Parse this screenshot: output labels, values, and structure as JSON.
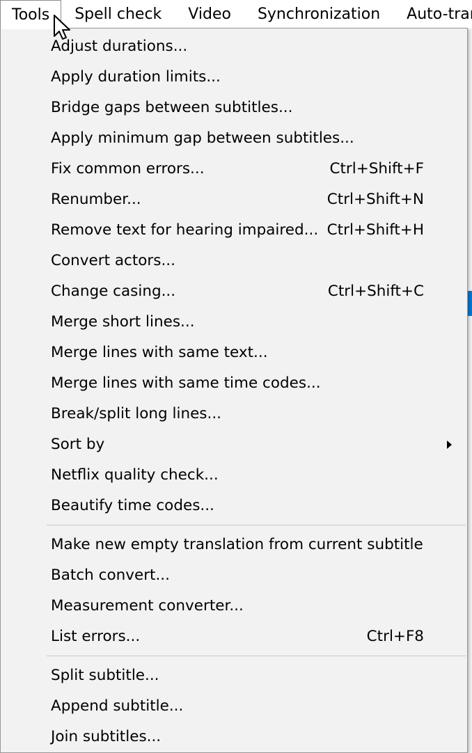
{
  "menubar": {
    "items": [
      {
        "label": "Tools",
        "active": true
      },
      {
        "label": "Spell check"
      },
      {
        "label": "Video"
      },
      {
        "label": "Synchronization"
      },
      {
        "label": "Auto-tran"
      }
    ]
  },
  "tools_menu": {
    "group1": [
      {
        "label": "Adjust durations...",
        "shortcut": ""
      },
      {
        "label": "Apply duration limits...",
        "shortcut": ""
      },
      {
        "label": "Bridge gaps between subtitles...",
        "shortcut": ""
      },
      {
        "label": "Apply minimum gap between subtitles...",
        "shortcut": ""
      },
      {
        "label": "Fix common errors...",
        "shortcut": "Ctrl+Shift+F"
      },
      {
        "label": "Renumber...",
        "shortcut": "Ctrl+Shift+N"
      },
      {
        "label": "Remove text for hearing impaired...",
        "shortcut": "Ctrl+Shift+H"
      },
      {
        "label": "Convert actors...",
        "shortcut": ""
      },
      {
        "label": "Change casing...",
        "shortcut": "Ctrl+Shift+C"
      },
      {
        "label": "Merge short lines...",
        "shortcut": ""
      },
      {
        "label": "Merge lines with same text...",
        "shortcut": ""
      },
      {
        "label": "Merge lines with same time codes...",
        "shortcut": ""
      },
      {
        "label": "Break/split long lines...",
        "shortcut": ""
      },
      {
        "label": "Sort by",
        "shortcut": "",
        "submenu": true
      },
      {
        "label": "Netflix quality check...",
        "shortcut": ""
      },
      {
        "label": "Beautify time codes...",
        "shortcut": ""
      }
    ],
    "group2": [
      {
        "label": "Make new empty translation from current subtitle",
        "shortcut": ""
      },
      {
        "label": "Batch convert...",
        "shortcut": ""
      },
      {
        "label": "Measurement converter...",
        "shortcut": ""
      },
      {
        "label": "List errors...",
        "shortcut": "Ctrl+F8"
      }
    ],
    "group3": [
      {
        "label": "Split subtitle...",
        "shortcut": ""
      },
      {
        "label": "Append subtitle...",
        "shortcut": ""
      },
      {
        "label": "Join subtitles...",
        "shortcut": ""
      }
    ]
  },
  "colors": {
    "menu_background": "#f2f2f2",
    "menu_border": "#979797",
    "separator": "#c8c8c8",
    "selection_accent": "#0078d7"
  },
  "icons": {
    "cursor": "mouse-pointer-icon",
    "submenu": "chevron-right-icon"
  }
}
